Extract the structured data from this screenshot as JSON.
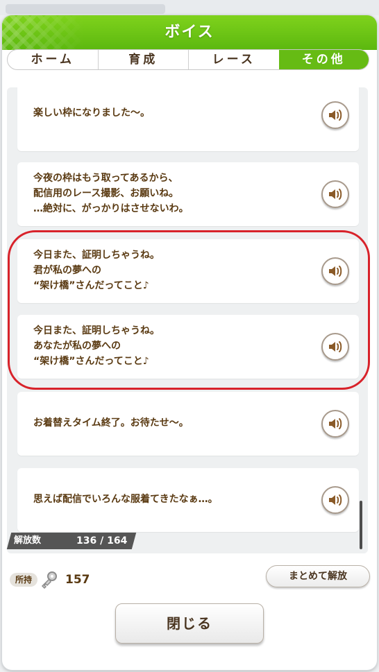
{
  "dialog": {
    "title": "ボイス"
  },
  "tabs": [
    {
      "label": "ホーム",
      "active": false
    },
    {
      "label": "育成",
      "active": false
    },
    {
      "label": "レース",
      "active": false
    },
    {
      "label": "その他",
      "active": true
    }
  ],
  "voices": [
    {
      "text": "楽しい枠になりました～。"
    },
    {
      "text": "今夜の枠はもう取ってあるから、\n配信用のレース撮影、お願いね。\n…絶対に、がっかりはさせないわ。"
    },
    {
      "text": "今日また、証明しちゃうね。\n君が私の夢への\n“架け橋”さんだってこと♪"
    },
    {
      "text": "今日また、証明しちゃうね。\nあなたが私の夢への\n“架け橋”さんだってこと♪"
    },
    {
      "text": "お着替えタイム終了。お待たせ～。"
    },
    {
      "text": "思えば配信でいろんな服着てきたなぁ…。"
    }
  ],
  "released": {
    "label": "解放数",
    "count": "136 / 164"
  },
  "owned": {
    "label": "所持",
    "count": "157"
  },
  "buttons": {
    "release_all": "まとめて解放",
    "close": "閉じる"
  },
  "colors": {
    "header": "#66bb14",
    "active_tab": "#66bb14",
    "text": "#5a3a12",
    "highlight": "#d8222a"
  },
  "icons": {
    "play": "speaker-icon",
    "key": "key-icon"
  }
}
